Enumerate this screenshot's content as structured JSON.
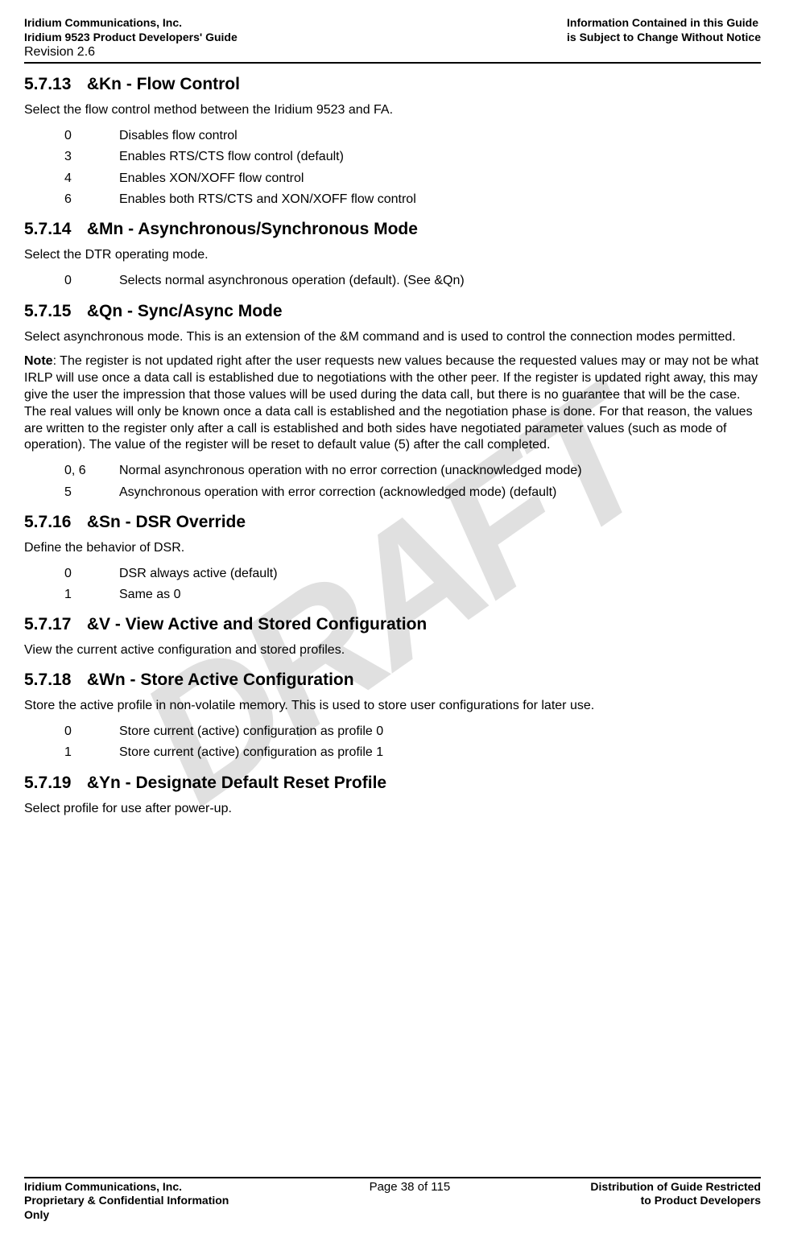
{
  "header": {
    "left1": "Iridium Communications, Inc.",
    "left2": "Iridium 9523 Product Developers' Guide",
    "right1": "Information Contained in this Guide",
    "right2": "is Subject to Change Without Notice",
    "revision": "Revision 2.6"
  },
  "sections": {
    "s1": {
      "num": "5.7.13",
      "title": "&Kn - Flow Control",
      "intro": "Select the flow control method between the Iridium 9523 and FA.",
      "items": [
        {
          "k": "0",
          "v": "Disables flow control"
        },
        {
          "k": "3",
          "v": "Enables RTS/CTS flow control (default)"
        },
        {
          "k": "4",
          "v": "Enables XON/XOFF flow control"
        },
        {
          "k": "6",
          "v": "Enables both RTS/CTS and XON/XOFF flow control"
        }
      ]
    },
    "s2": {
      "num": "5.7.14",
      "title": "&Mn - Asynchronous/Synchronous Mode",
      "intro": "Select the DTR operating mode.",
      "items": [
        {
          "k": "0",
          "v": "Selects normal asynchronous operation (default). (See &Qn)"
        }
      ]
    },
    "s3": {
      "num": "5.7.15",
      "title": "&Qn - Sync/Async Mode",
      "intro": "Select asynchronous mode. This is an extension of the &M command and is used to control the connection modes permitted.",
      "note_label": "Note",
      "note": ": The register is not updated right after the user requests new values because the requested values may or may not be what IRLP will use once a data call is established due to negotiations with the other peer. If the register is updated right away, this may give the user the impression that those values will be used during the data call, but there is no guarantee that will be the case. The real values will only be known once a data call is established and the negotiation phase is done. For that reason, the values are written to the register only after a call is established and both sides have negotiated parameter values (such as mode of operation). The value of the register will be reset to default value (5) after the call completed.",
      "items": [
        {
          "k": "0, 6",
          "v": "Normal asynchronous operation with no error correction (unacknowledged mode)"
        },
        {
          "k": "5",
          "v": "Asynchronous operation with error correction (acknowledged mode) (default)"
        }
      ]
    },
    "s4": {
      "num": "5.7.16",
      "title": "&Sn - DSR Override",
      "intro": "Define the behavior of DSR.",
      "items": [
        {
          "k": "0",
          "v": "DSR always active (default)"
        },
        {
          "k": "1",
          "v": "Same as 0"
        }
      ]
    },
    "s5": {
      "num": "5.7.17",
      "title": "&V - View Active and Stored Configuration",
      "intro": "View the current active configuration and stored profiles."
    },
    "s6": {
      "num": "5.7.18",
      "title": "&Wn - Store Active Configuration",
      "intro": "Store the active profile in non-volatile memory. This is used to store user configurations for later use.",
      "items": [
        {
          "k": "0",
          "v": "Store current (active) configuration as profile 0"
        },
        {
          "k": "1",
          "v": "Store current (active) configuration as profile 1"
        }
      ]
    },
    "s7": {
      "num": "5.7.19",
      "title": "&Yn - Designate Default Reset Profile",
      "intro": "Select profile for use after power-up."
    }
  },
  "footer": {
    "left1": "Iridium Communications, Inc.",
    "left2": "Proprietary & Confidential Information",
    "left3": "Only",
    "center": "Page 38 of 115",
    "right1": "Distribution of Guide Restricted",
    "right2": "to Product Developers"
  },
  "watermark": "DRAFT"
}
